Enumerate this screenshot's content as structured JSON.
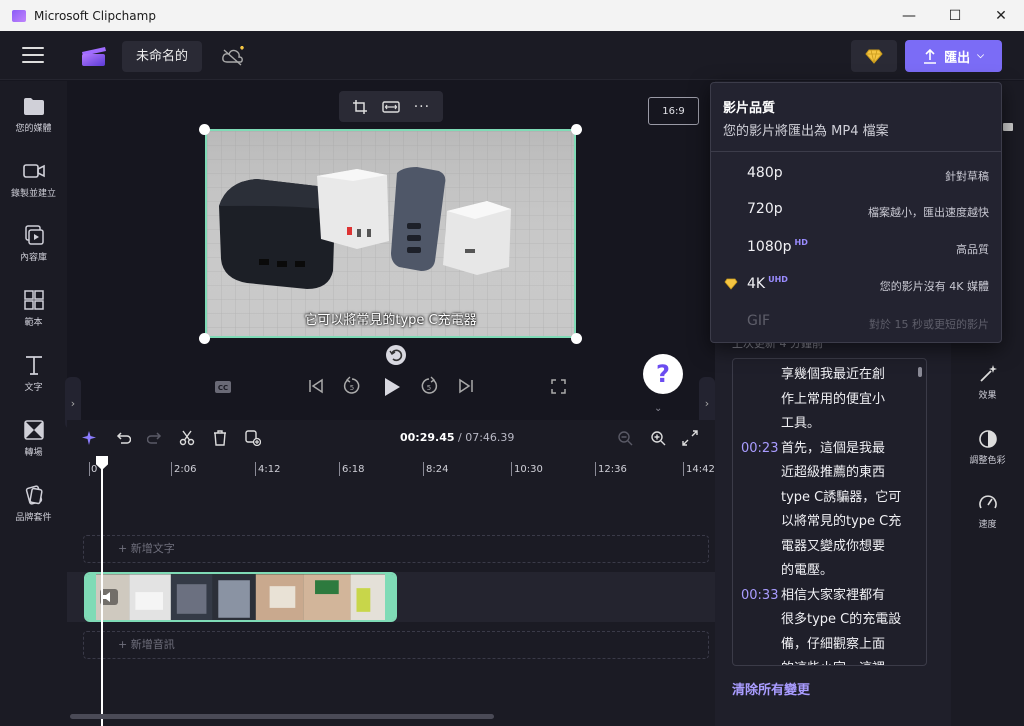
{
  "window": {
    "title": "Microsoft Clipchamp",
    "controls": [
      "—",
      "☐",
      "✕"
    ]
  },
  "header": {
    "project_name": "未命名的",
    "export_label": "匯出"
  },
  "sidebar": {
    "items": [
      {
        "label": "您的媒體",
        "icon": "folder-icon"
      },
      {
        "label": "錄製並建立",
        "icon": "camera-icon"
      },
      {
        "label": "內容庫",
        "icon": "library-icon"
      },
      {
        "label": "範本",
        "icon": "templates-icon"
      },
      {
        "label": "文字",
        "icon": "text-icon"
      },
      {
        "label": "轉場",
        "icon": "transitions-icon"
      },
      {
        "label": "品牌套件",
        "icon": "brand-kit-icon"
      }
    ]
  },
  "stage": {
    "aspect_ratio": "16:9",
    "subtitle": "它可以將常見的type C充電器"
  },
  "timeline": {
    "current_time": "00:29.45",
    "total_time": "/ 07:46.39",
    "ruler": [
      "0",
      "2:06",
      "4:12",
      "6:18",
      "8:24",
      "10:30",
      "12:36",
      "14:42"
    ],
    "add_text": "+ 新增文字",
    "add_audio": "+ 新增音訊"
  },
  "export_menu": {
    "title": "影片品質",
    "subtitle": "您的影片將匯出為 MP4 檔案",
    "options": [
      {
        "quality": "480p",
        "badge": "",
        "desc": "針對草稿",
        "disabled": false,
        "premium": false
      },
      {
        "quality": "720p",
        "badge": "",
        "desc": "檔案越小，匯出速度越快",
        "disabled": false,
        "premium": false
      },
      {
        "quality": "1080p",
        "badge": "HD",
        "desc": "高品質",
        "disabled": false,
        "premium": false
      },
      {
        "quality": "4K",
        "badge": "UHD",
        "desc": "您的影片沒有 4K 媒體",
        "disabled": false,
        "premium": true
      },
      {
        "quality": "GIF",
        "badge": "",
        "desc": "對於 15 秒或更短的影片",
        "disabled": true,
        "premium": false
      }
    ]
  },
  "transcript": {
    "status": "上次更新 4 分鐘前",
    "lines": [
      {
        "ts": "",
        "text": "享幾個我最近在創"
      },
      {
        "ts": "",
        "text": "作上常用的便宜小"
      },
      {
        "ts": "",
        "text": "工具。"
      },
      {
        "ts": "00:23",
        "text": "首先，這個是我最"
      },
      {
        "ts": "",
        "text": "近超級推薦的東西"
      },
      {
        "ts": "",
        "text": "type C誘騙器，它可"
      },
      {
        "ts": "",
        "text": "以將常見的type C充"
      },
      {
        "ts": "",
        "text": "電器又變成你想要"
      },
      {
        "ts": "",
        "text": "的電壓。"
      },
      {
        "ts": "00:33",
        "text": "相信大家家裡都有"
      },
      {
        "ts": "",
        "text": "很多type C的充電設"
      },
      {
        "ts": "",
        "text": "備，仔細觀察上面"
      },
      {
        "ts": "",
        "text": "的這些小字，這裡"
      }
    ],
    "clear_all": "清除所有變更"
  },
  "right_tools": {
    "items": [
      {
        "label": "效果",
        "icon": "magic-wand-icon"
      },
      {
        "label": "調整色彩",
        "icon": "color-adjust-icon"
      },
      {
        "label": "速度",
        "icon": "speed-gauge-icon"
      }
    ]
  },
  "colors": {
    "accent": "#7b6cf6",
    "selection": "#7fdbb6",
    "timestamp": "#a99cff",
    "premium": "#f5c542"
  }
}
